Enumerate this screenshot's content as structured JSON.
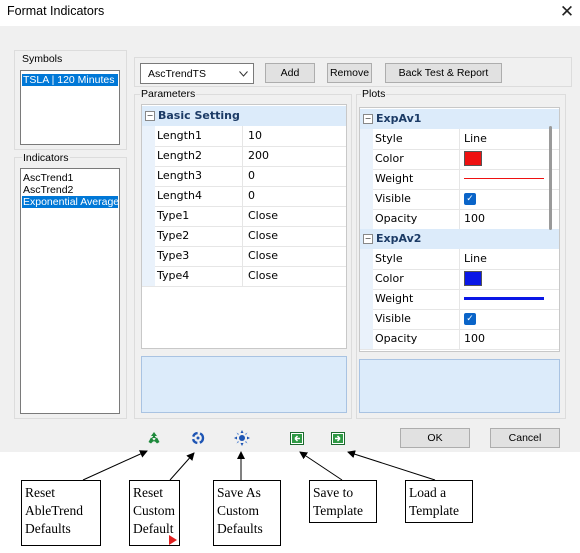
{
  "window": {
    "title": "Format Indicators",
    "close_glyph": "✕"
  },
  "symbols": {
    "label": "Symbols",
    "items": [
      "TSLA | 120 Minutes"
    ]
  },
  "indicators": {
    "label": "Indicators",
    "items": [
      "AscTrend1",
      "AscTrend2",
      "Exponential Average"
    ]
  },
  "toolbar": {
    "indicator_select": "AscTrendTS",
    "add_label": "Add",
    "remove_label": "Remove",
    "backtest_label": "Back Test & Report"
  },
  "parameters": {
    "label": "Parameters",
    "category": "Basic Setting",
    "rows": [
      {
        "name": "Length1",
        "value": "10"
      },
      {
        "name": "Length2",
        "value": "200"
      },
      {
        "name": "Length3",
        "value": "0"
      },
      {
        "name": "Length4",
        "value": "0"
      },
      {
        "name": "Type1",
        "value": "Close"
      },
      {
        "name": "Type2",
        "value": "Close"
      },
      {
        "name": "Type3",
        "value": "Close"
      },
      {
        "name": "Type4",
        "value": "Close"
      }
    ]
  },
  "plots": {
    "label": "Plots",
    "groups": [
      {
        "name": "ExpAv1",
        "style": "Line",
        "color": "#ee1111",
        "opacity": "100"
      },
      {
        "name": "ExpAv2",
        "style": "Line",
        "color": "#0a17e6",
        "opacity": "100"
      }
    ],
    "row_labels": {
      "style": "Style",
      "color": "Color",
      "weight": "Weight",
      "visible": "Visible",
      "opacity": "Opacity"
    }
  },
  "footer": {
    "icons": [
      "reset-abletrend-defaults-icon",
      "reset-custom-default-icon",
      "save-as-custom-defaults-icon",
      "save-to-template-icon",
      "load-a-template-icon"
    ],
    "ok_label": "OK",
    "cancel_label": "Cancel"
  },
  "annotations": [
    {
      "text": "Reset AbleTrend Defaults"
    },
    {
      "text": "Reset Custom Default"
    },
    {
      "text": "Save As Custom Defaults"
    },
    {
      "text": "Save to Template"
    },
    {
      "text": "Load a Template"
    }
  ],
  "colors": {
    "accent": "#0078d7",
    "grid_header": "#dcebfa",
    "icon_green": "#1f8a3c",
    "icon_blue": "#1e55b4"
  }
}
